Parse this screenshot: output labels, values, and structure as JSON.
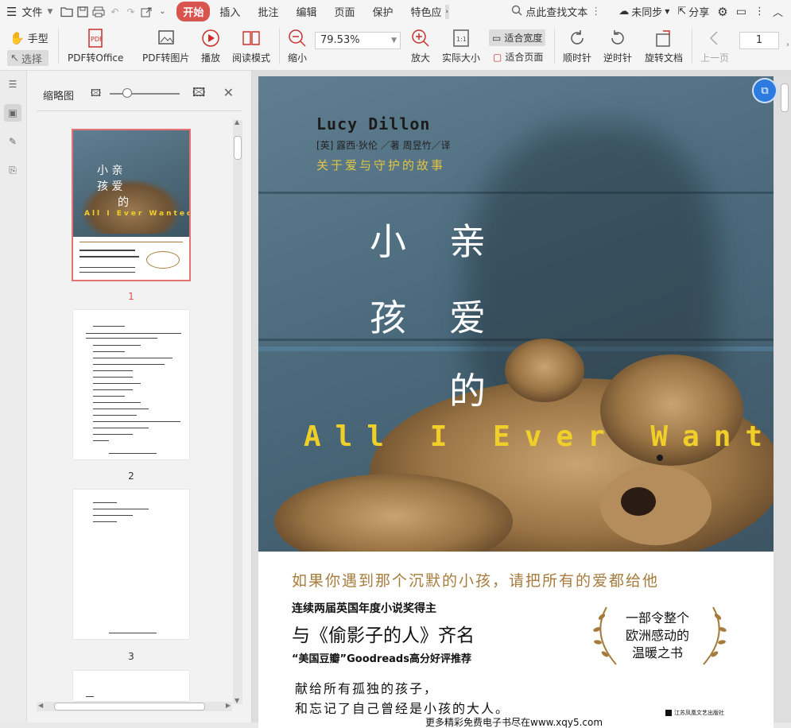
{
  "menubar": {
    "file_label": "文件",
    "tabs": [
      {
        "label": "开始",
        "active": true
      },
      {
        "label": "插入"
      },
      {
        "label": "批注"
      },
      {
        "label": "编辑"
      },
      {
        "label": "页面"
      },
      {
        "label": "保护"
      },
      {
        "label": "特色应"
      }
    ],
    "search_placeholder": "点此查找文本",
    "sync_label": "未同步",
    "share_label": "分享"
  },
  "toolbar": {
    "hand_label": "手型",
    "select_label": "选择",
    "pdf_to_office": "PDF转Office",
    "pdf_to_image": "PDF转图片",
    "play": "播放",
    "read_mode": "阅读模式",
    "zoom_out": "缩小",
    "zoom_value": "79.53%",
    "zoom_in": "放大",
    "actual_size": "实际大小",
    "actual_size_icon_text": "1:1",
    "fit_width": "适合宽度",
    "fit_page": "适合页面",
    "rotate_cw": "顺时针",
    "rotate_ccw": "逆时针",
    "rotate_doc": "旋转文档",
    "prev_page": "上一页",
    "page_number": "1"
  },
  "thumbpanel": {
    "title": "缩略图",
    "pages": [
      {
        "number": "1",
        "selected": true
      },
      {
        "number": "2"
      },
      {
        "number": "3"
      }
    ]
  },
  "cover": {
    "author_en": "Lucy Dillon",
    "byline": "[英]  露西·狄伦 ／著      周昱竹／译",
    "tagline": "关于爱与守护的故事",
    "title_chars": [
      "小",
      "亲",
      "孩",
      "爱",
      "的"
    ],
    "title_en": "All I Ever Wanted",
    "hook": "如果你遇到那个沉默的小孩，请把所有的爱都给他",
    "award": "连续两届英国年度小说奖得主",
    "compare": "与《偷影子的人》齐名",
    "recommend": "“美国豆瓣”Goodreads高分好评推荐",
    "laurel": [
      "一部令整个",
      "欧洲感动的",
      "温暖之书"
    ],
    "dedication_1": "献给所有孤独的孩子，",
    "dedication_2": "和忘记了自己曾经是小孩的大人。",
    "publisher": "江苏凤凰文艺出版社",
    "watermark": "更多精彩免费电子书尽在www.xqy5.com"
  },
  "colors": {
    "accent_red": "#d9534f",
    "tagline_yellow": "#e2c443",
    "hook_brown": "#a67c3d",
    "float_blue": "#2e7be0"
  }
}
